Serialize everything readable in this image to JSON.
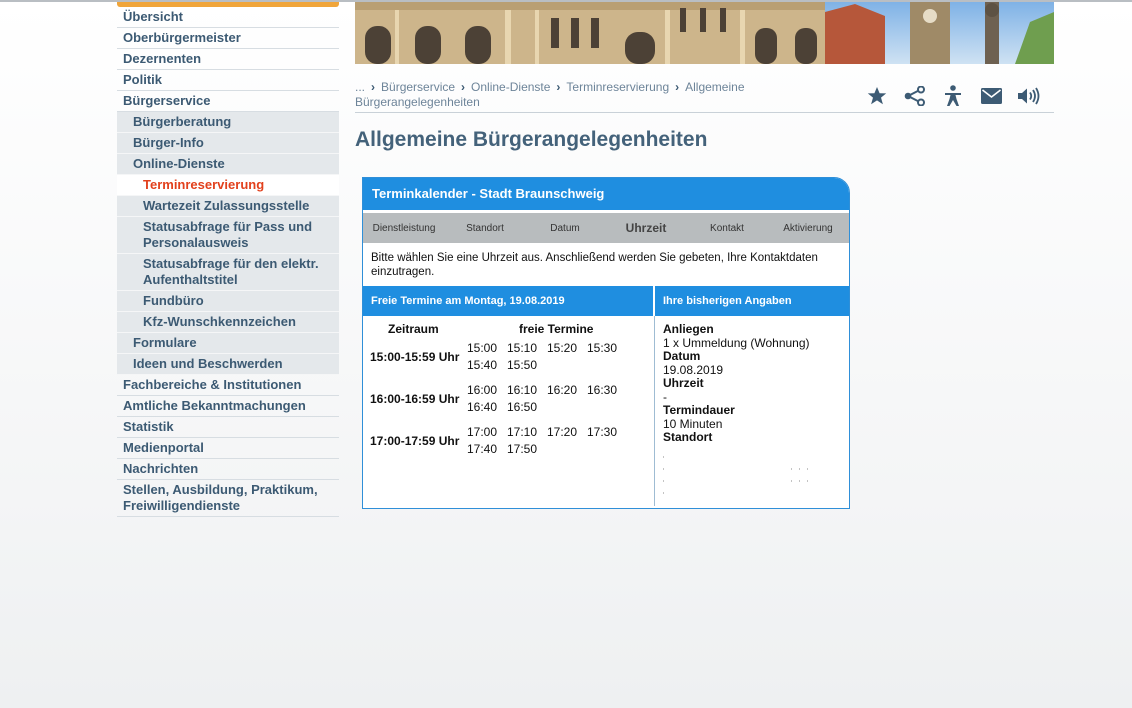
{
  "sidebar": {
    "items": [
      {
        "label": "Übersicht",
        "level": 1
      },
      {
        "label": "Oberbürgermeister",
        "level": 1
      },
      {
        "label": "Dezernenten",
        "level": 1
      },
      {
        "label": "Politik",
        "level": 1
      },
      {
        "label": "Bürgerservice",
        "level": 1
      },
      {
        "label": "Bürgerberatung",
        "level": 2
      },
      {
        "label": "Bürger-Info",
        "level": 2
      },
      {
        "label": "Online-Dienste",
        "level": 2
      },
      {
        "label": "Terminreservierung",
        "level": 3,
        "active": true
      },
      {
        "label": "Wartezeit Zulassungsstelle",
        "level": 3
      },
      {
        "label": "Statusabfrage für Pass und Personalausweis",
        "level": 3
      },
      {
        "label": "Statusabfrage für den elektr. Aufenthaltstitel",
        "level": 3
      },
      {
        "label": "Fundbüro",
        "level": 3
      },
      {
        "label": "Kfz-Wunschkennzeichen",
        "level": 3
      },
      {
        "label": "Formulare",
        "level": 2
      },
      {
        "label": "Ideen und Beschwerden",
        "level": 2
      },
      {
        "label": "Fachbereiche & Institutionen",
        "level": 1
      },
      {
        "label": "Amtliche Bekanntmachungen",
        "level": 1
      },
      {
        "label": "Statistik",
        "level": 1
      },
      {
        "label": "Medienportal",
        "level": 1
      },
      {
        "label": "Nachrichten",
        "level": 1
      },
      {
        "label": "Stellen, Ausbildung, Praktikum, Freiwilligendienste",
        "level": 1
      }
    ]
  },
  "breadcrumb": {
    "ellipsis": "...",
    "items": [
      "Bürgerservice",
      "Online-Dienste",
      "Terminreservierung",
      "Allgemeine Bürgerangelegenheiten"
    ]
  },
  "tools": [
    "star-icon",
    "share-icon",
    "accessibility-icon",
    "mail-icon",
    "speaker-icon"
  ],
  "page_title": "Allgemeine Bürgerangelegenheiten",
  "calendar": {
    "title": "Terminkalender - Stadt Braunschweig",
    "steps": [
      "Dienstleistung",
      "Standort",
      "Datum",
      "Uhrzeit",
      "Kontakt",
      "Aktivierung"
    ],
    "current_step": "Uhrzeit",
    "instruction": "Bitte wählen Sie eine Uhrzeit aus. Anschließend werden Sie gebeten, Ihre Kontaktdaten einzutragen.",
    "slots_header": "Freie Termine am Montag, 19.08.2019",
    "summary_header": "Ihre bisherigen Angaben",
    "col_zeitraum": "Zeitraum",
    "col_frei": "freie Termine",
    "groups": [
      {
        "range": "15:00-15:59 Uhr",
        "times": [
          "15:00",
          "15:10",
          "15:20",
          "15:30",
          "15:40",
          "15:50"
        ]
      },
      {
        "range": "16:00-16:59 Uhr",
        "times": [
          "16:00",
          "16:10",
          "16:20",
          "16:30",
          "16:40",
          "16:50"
        ]
      },
      {
        "range": "17:00-17:59 Uhr",
        "times": [
          "17:00",
          "17:10",
          "17:20",
          "17:30",
          "17:40",
          "17:50"
        ]
      }
    ],
    "summary": {
      "anliegen_label": "Anliegen",
      "anliegen_value": "1 x Ummeldung (Wohnung)",
      "datum_label": "Datum",
      "datum_value": "19.08.2019",
      "uhrzeit_label": "Uhrzeit",
      "uhrzeit_value": "-",
      "dauer_label": "Termindauer",
      "dauer_value": "10 Minuten",
      "standort_label": "Standort"
    }
  }
}
